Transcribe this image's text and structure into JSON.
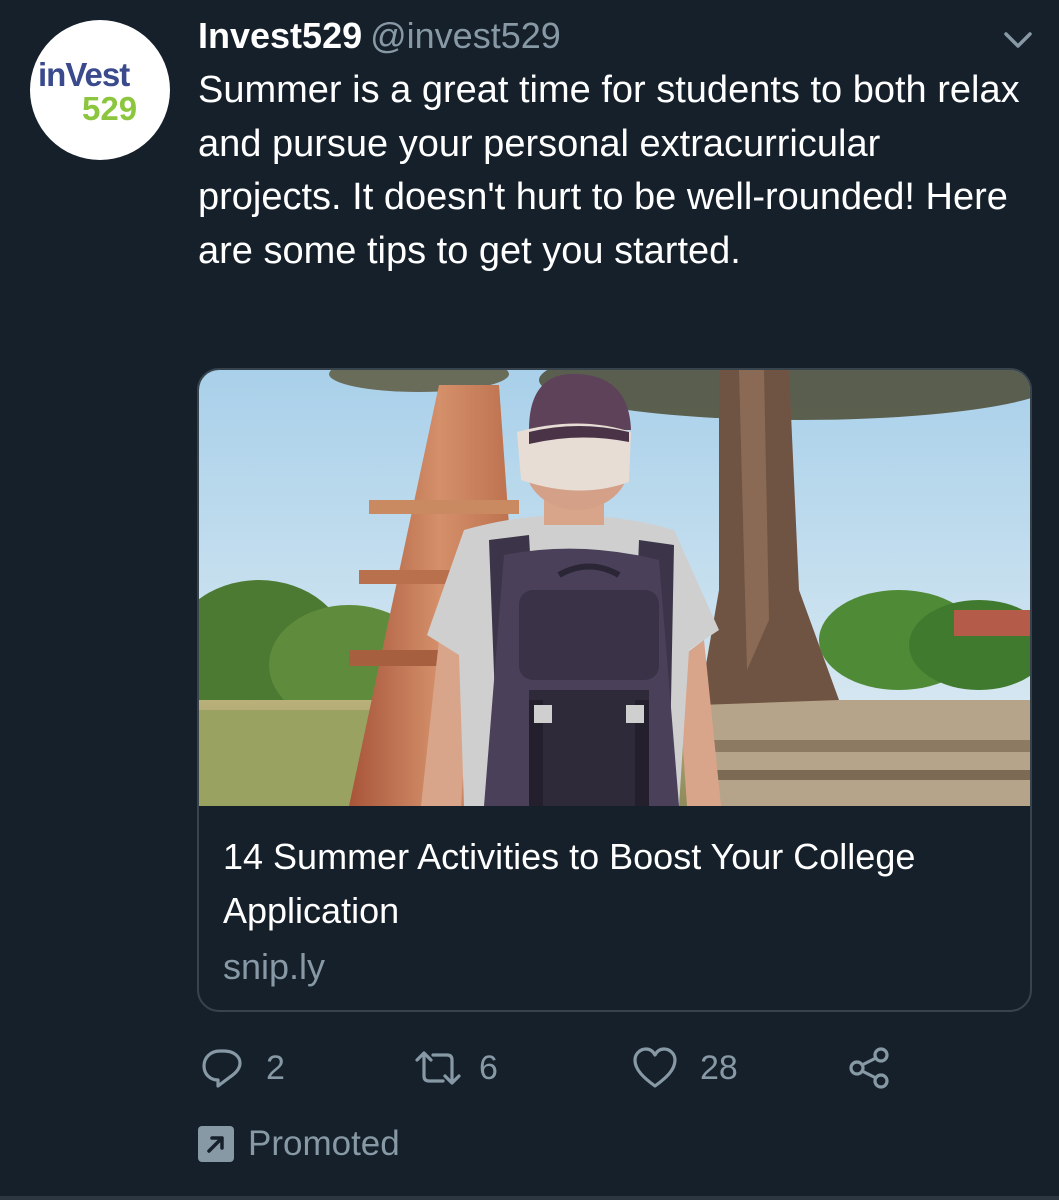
{
  "author": {
    "display_name": "Invest529",
    "handle": "@invest529",
    "avatar_text_top": "inVest",
    "avatar_text_bottom": "529"
  },
  "tweet": {
    "text": "Summer is a great time for students to both relax and pursue your personal extracurricular projects. It doesn't hurt to be well-rounded! Here are some tips to get you started."
  },
  "card": {
    "title": "14 Summer Activities to Boost Your College Application",
    "domain": "snip.ly"
  },
  "actions": {
    "reply_count": "2",
    "retweet_count": "6",
    "like_count": "28"
  },
  "promoted_label": "Promoted",
  "colors": {
    "background": "#15202b",
    "secondary_text": "#8899a6",
    "border": "#38444d",
    "logo_blue": "#3a4a8c",
    "logo_green": "#8cc63f"
  },
  "icons": [
    "chevron-down-icon",
    "reply-icon",
    "retweet-icon",
    "like-icon",
    "share-icon",
    "promoted-icon"
  ]
}
